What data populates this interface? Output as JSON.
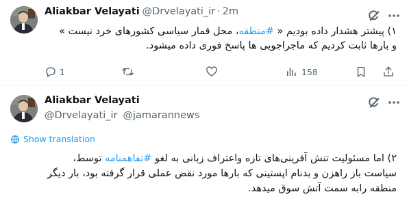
{
  "tweet1": {
    "display_name": "Aliakbar Velayati",
    "handle": "@Drvelayati_ir",
    "separator": "·",
    "time": "2m",
    "text_parts": [
      {
        "t": "۱) پیشتر هشدار داده بودیم « "
      },
      {
        "t": "#منطقه",
        "link": true
      },
      {
        "t": "، محل قمار سیاسی کشورهای خرد نیست »"
      }
    ],
    "text_line2": "و بارها ثابت کردیم که ماجراجویی ها پاسخ فوری داده میشود.",
    "replies": "1",
    "views": "158"
  },
  "tweet2": {
    "display_name": "Aliakbar Velayati",
    "handle": "@Drvelayati_ir",
    "via": "@jamarannews",
    "show_translation": "Show translation",
    "line1_parts": [
      {
        "t": "۲) اما مسئولیت تنش آفرینی‌های تازه واعتراف زبانی به لغو "
      },
      {
        "t": "#تفاهمنامه",
        "link": true
      },
      {
        "t": " توسط،"
      }
    ],
    "line2": "سیاست باز راهزن و بدنام اپستینی که بارها مورد نقض عملی قرار گرفته بود، بار دیگر",
    "line3": "منطقه رابه سمت آتش سوق میدهد."
  },
  "colors": {
    "link": "#1d9bf0",
    "muted": "#536471",
    "text": "#0f1419",
    "divider": "#eff3f4"
  },
  "icons": [
    "grok-icon",
    "more-icon",
    "reply-icon",
    "retweet-icon",
    "like-icon",
    "views-icon",
    "bookmark-icon",
    "share-icon",
    "globe-icon"
  ]
}
